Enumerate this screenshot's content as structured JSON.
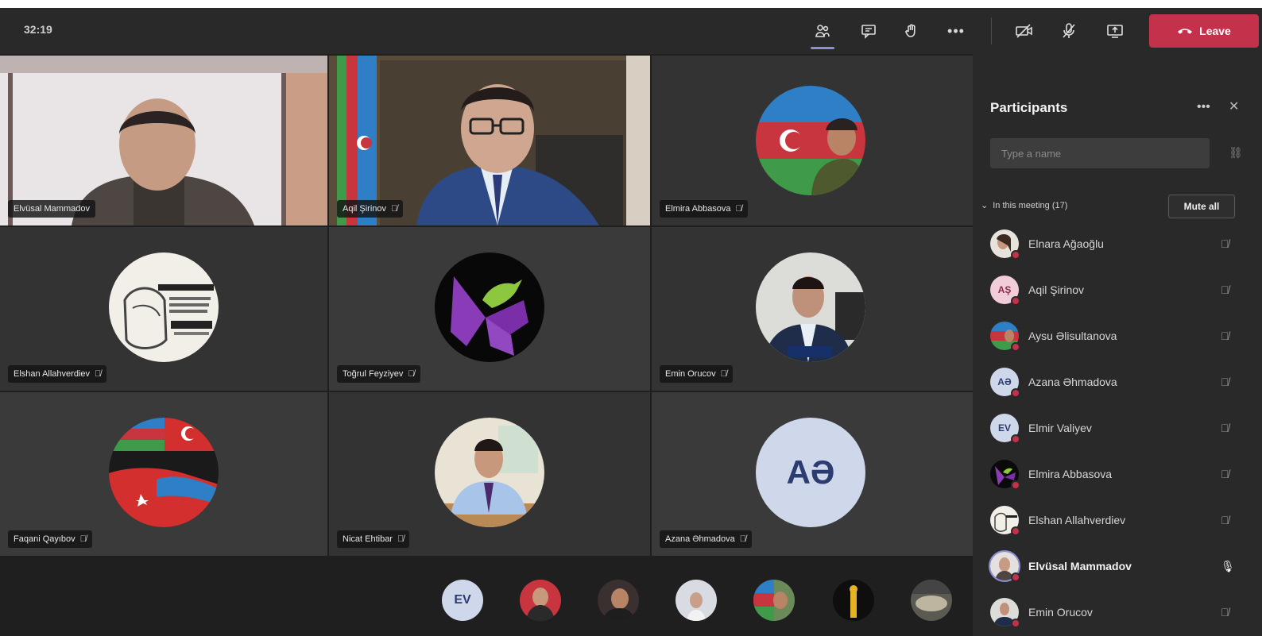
{
  "meeting": {
    "timer": "32:19"
  },
  "toolbar": {
    "leave_label": "Leave",
    "colors": {
      "leave": "#c4314b",
      "accent": "#8a8fd6"
    }
  },
  "tiles": [
    {
      "name": "Elvüsal Mammadov",
      "kind": "video"
    },
    {
      "name": "Aqil Şirinov",
      "kind": "video"
    },
    {
      "name": "Elmira Abbasova",
      "kind": "avatar"
    },
    {
      "name": "Elshan Allahverdiev",
      "kind": "avatar"
    },
    {
      "name": "Toğrul Feyziyev",
      "kind": "avatar"
    },
    {
      "name": "Emin Orucov",
      "kind": "avatar"
    },
    {
      "name": "Faqani Qayıbov",
      "kind": "avatar"
    },
    {
      "name": "Nicat Ehtibar",
      "kind": "avatar"
    },
    {
      "name": "Azana Əhmadova",
      "kind": "initials",
      "initials": "AƏ"
    }
  ],
  "strip": [
    {
      "initials": "EV"
    }
  ],
  "panel": {
    "title": "Participants",
    "search_placeholder": "Type a name",
    "section_label": "In this meeting (17)",
    "mute_all_label": "Mute all",
    "participants": [
      {
        "name": "Elnara Ağaoğlu",
        "initials": "",
        "mic": "off"
      },
      {
        "name": "Aqil Şirinov",
        "initials": "AŞ",
        "mic": "off"
      },
      {
        "name": "Aysu Əlisultanova",
        "initials": "",
        "mic": "off"
      },
      {
        "name": "Azana Əhmadova",
        "initials": "AƏ",
        "mic": "off"
      },
      {
        "name": "Elmir Valiyev",
        "initials": "EV",
        "mic": "off"
      },
      {
        "name": "Elmira Abbasova",
        "initials": "",
        "mic": "off"
      },
      {
        "name": "Elshan Allahverdiev",
        "initials": "",
        "mic": "off"
      },
      {
        "name": "Elvüsal Mammadov",
        "initials": "",
        "mic": "on"
      },
      {
        "name": "Emin Orucov",
        "initials": "",
        "mic": "off"
      }
    ]
  }
}
